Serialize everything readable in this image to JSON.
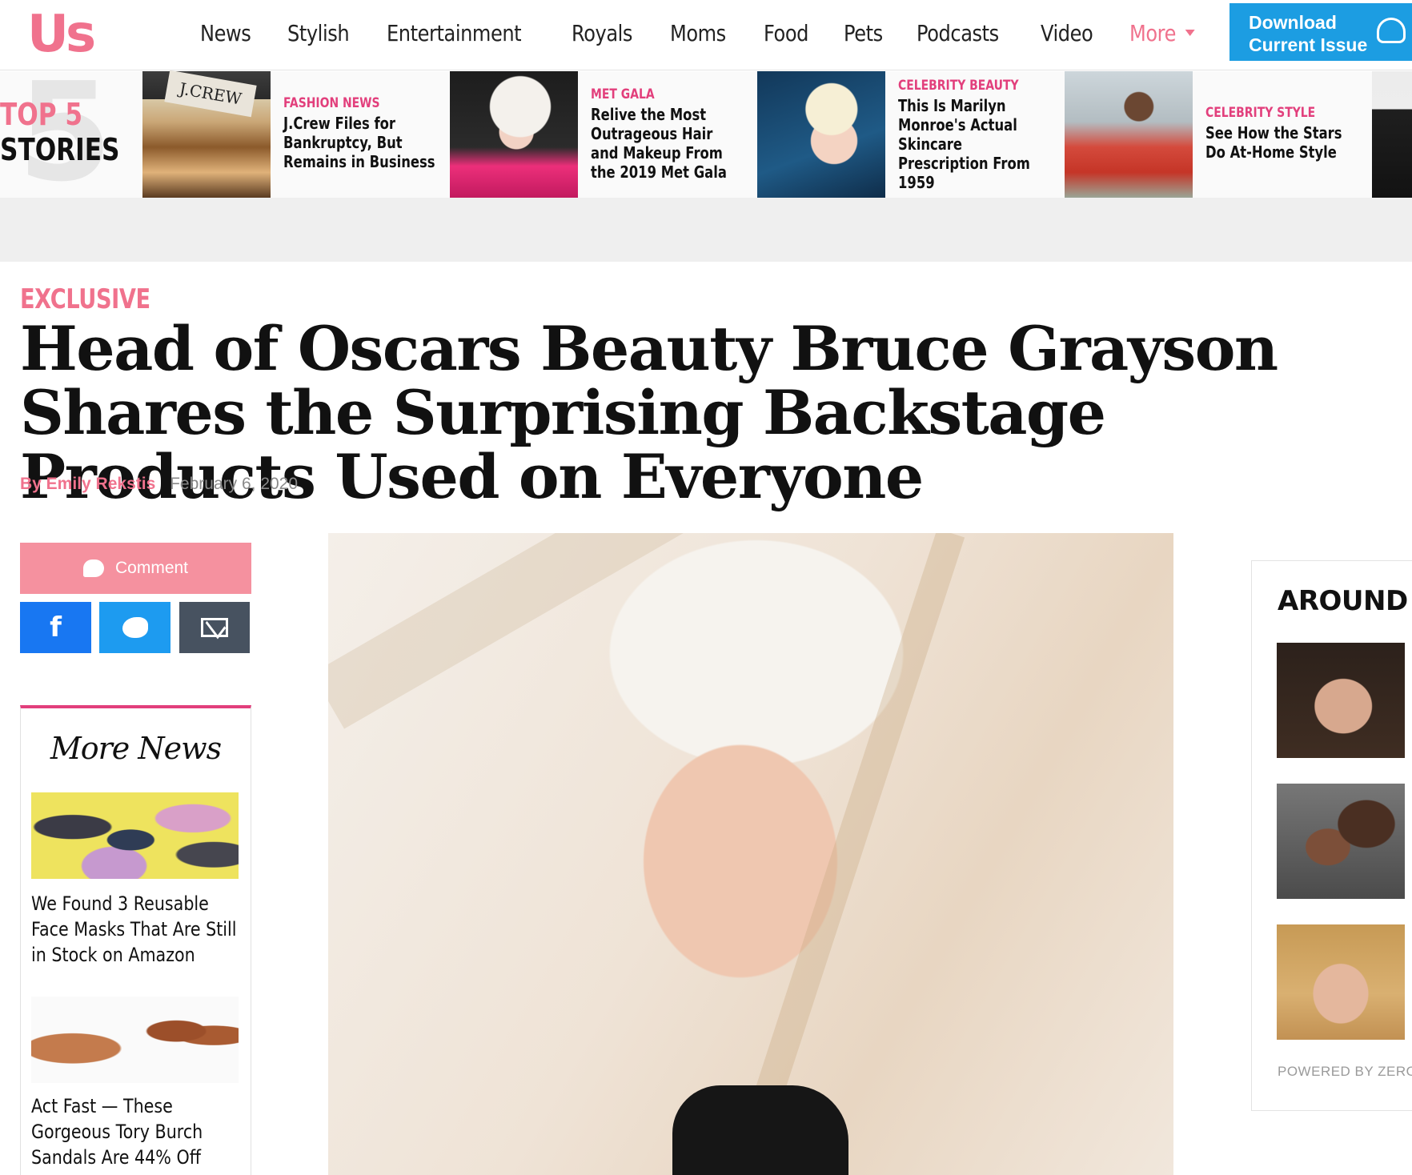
{
  "brand": {
    "logo": "Us",
    "accent": "#f0728d",
    "download_blue": "#1c9de2"
  },
  "nav": {
    "items": [
      "News",
      "Stylish",
      "Entertainment",
      "Royals",
      "Moms",
      "Food",
      "Pets",
      "Podcasts",
      "Video"
    ],
    "more_label": "More",
    "download_line1": "Download",
    "download_line2": "Current Issue"
  },
  "top5": {
    "big_number": "5",
    "label_line1": "TOP 5",
    "label_line2": "STORIES",
    "stories": [
      {
        "category": "FASHION NEWS",
        "headline": "J.Crew Files for Bankruptcy, But Remains in Business",
        "sign": "J.CREW"
      },
      {
        "category": "MET GALA",
        "headline": "Relive the Most Outrageous Hair and Makeup From the 2019 Met Gala"
      },
      {
        "category": "CELEBRITY BEAUTY",
        "headline": "This Is Marilyn Monroe's Actual Skincare Prescription From 1959"
      },
      {
        "category": "CELEBRITY STYLE",
        "headline": "See How the Stars Do At-Home Style"
      }
    ]
  },
  "article": {
    "kicker": "EXCLUSIVE",
    "title": "Head of Oscars Beauty Bruce Grayson Shares the Surprising Backstage Products Used on Everyone",
    "author": "By Emily Rekstis",
    "date": "February 6, 2020"
  },
  "share": {
    "comment_label": "Comment",
    "facebook_glyph": "f"
  },
  "more_news": {
    "heading": "More News",
    "items": [
      {
        "headline": "We Found 3 Reusable Face Masks That Are Still in Stock on Amazon"
      },
      {
        "headline": "Act Fast — These Gorgeous Tory Burch Sandals Are 44% Off"
      }
    ]
  },
  "around": {
    "heading": "AROUND T",
    "powered": "POWERED BY ZERO"
  }
}
